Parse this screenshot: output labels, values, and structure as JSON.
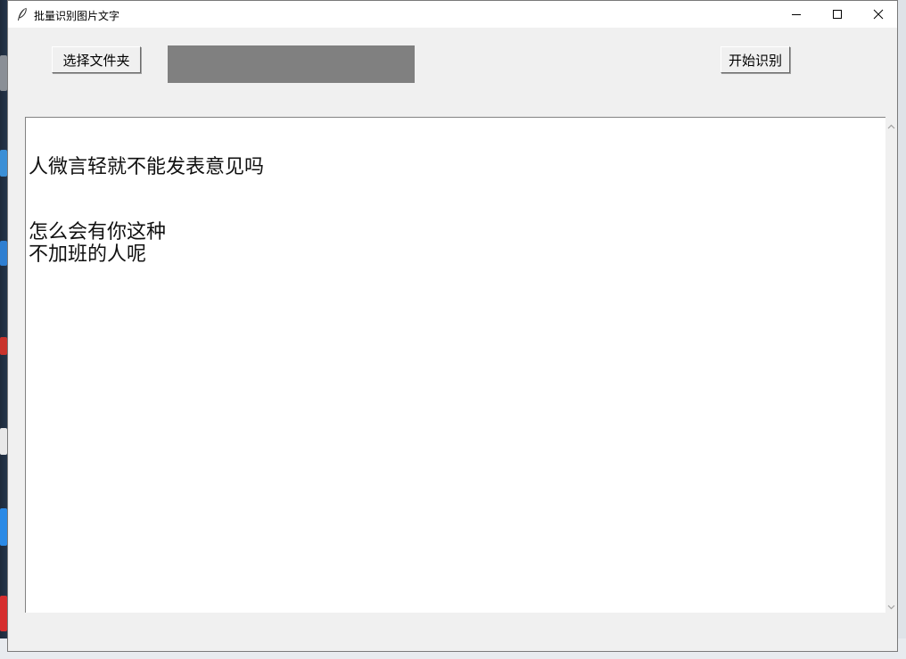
{
  "window": {
    "title": "批量识别图片文字"
  },
  "toolbar": {
    "select_folder_label": "选择文件夹",
    "start_label": "开始识别"
  },
  "output": {
    "text": "\n人微言轻就不能发表意见吗\n\n\n怎么会有你这种\n不加班的人呢"
  },
  "icons": {
    "app": "feather-icon",
    "minimize": "minimize-icon",
    "maximize": "maximize-icon",
    "close": "close-icon",
    "scroll_up": "chevron-up-icon",
    "scroll_down": "chevron-down-icon"
  },
  "colors": {
    "window_bg": "#f0f0f0",
    "path_label_bg": "#808080",
    "text_area_bg": "#ffffff"
  }
}
